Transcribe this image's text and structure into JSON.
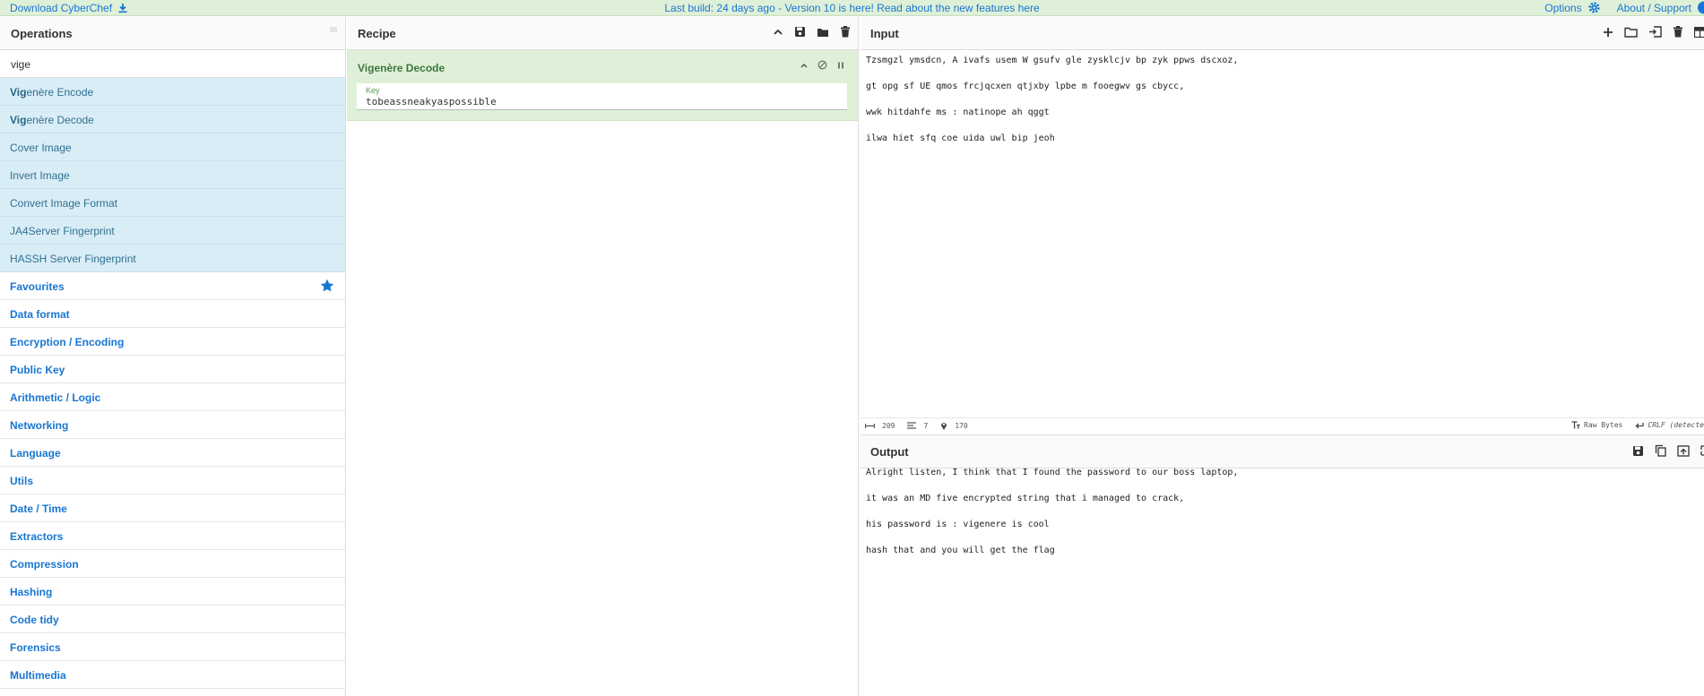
{
  "banner": {
    "download_label": "Download CyberChef",
    "build_text": "Last build: 24 days ago - Version 10 is here! Read about the new features here",
    "options_label": "Options",
    "about_label": "About / Support"
  },
  "operations": {
    "title": "Operations",
    "search_value": "vige",
    "results": [
      {
        "match": "Vig",
        "rest": "enère Encode"
      },
      {
        "match": "Vig",
        "rest": "enère Decode"
      },
      {
        "match": "",
        "rest": "Cover Image"
      },
      {
        "match": "",
        "rest": "Invert Image"
      },
      {
        "match": "",
        "rest": "Convert Image Format"
      },
      {
        "match": "",
        "rest": "JA4Server Fingerprint"
      },
      {
        "match": "",
        "rest": "HASSH Server Fingerprint"
      }
    ],
    "categories": [
      "Favourites",
      "Data format",
      "Encryption / Encoding",
      "Public Key",
      "Arithmetic / Logic",
      "Networking",
      "Language",
      "Utils",
      "Date / Time",
      "Extractors",
      "Compression",
      "Hashing",
      "Code tidy",
      "Forensics",
      "Multimedia"
    ]
  },
  "recipe": {
    "title": "Recipe",
    "operation_name": "Vigenère Decode",
    "key_label": "Key",
    "key_value": "tobeassneakyaspossible"
  },
  "input": {
    "title": "Input",
    "lines": [
      "Tzsmgzl ymsdcn, A ivafs usem W gsufv gle zysklcjv bp zyk ppws dscxoz,",
      "gt opg sf UE qmos frcjqcxen qtjxby lpbe m fooegwv gs cbycc,",
      "wwk hitdahfe ms : natinope ah qggt",
      "ilwa hiet sfq coe uida uwl bip jeoh"
    ],
    "stats": {
      "length": "209",
      "lines": "7",
      "position": "170"
    },
    "raw_bytes_label": "Raw Bytes",
    "eol_label": "CRLF (detecte"
  },
  "output": {
    "title": "Output",
    "lines": [
      "Alright listen, I think that I found the password to our boss laptop,",
      "it was an MD five encrypted string that i managed to crack,",
      "his password is : vigenere is cool",
      "hash that and you will get the flag"
    ]
  },
  "colors": {
    "accent": "#1976d2",
    "banner_bg": "#dff0d8",
    "result_bg": "#d9edf7",
    "recipe_green": "#3c763d"
  }
}
